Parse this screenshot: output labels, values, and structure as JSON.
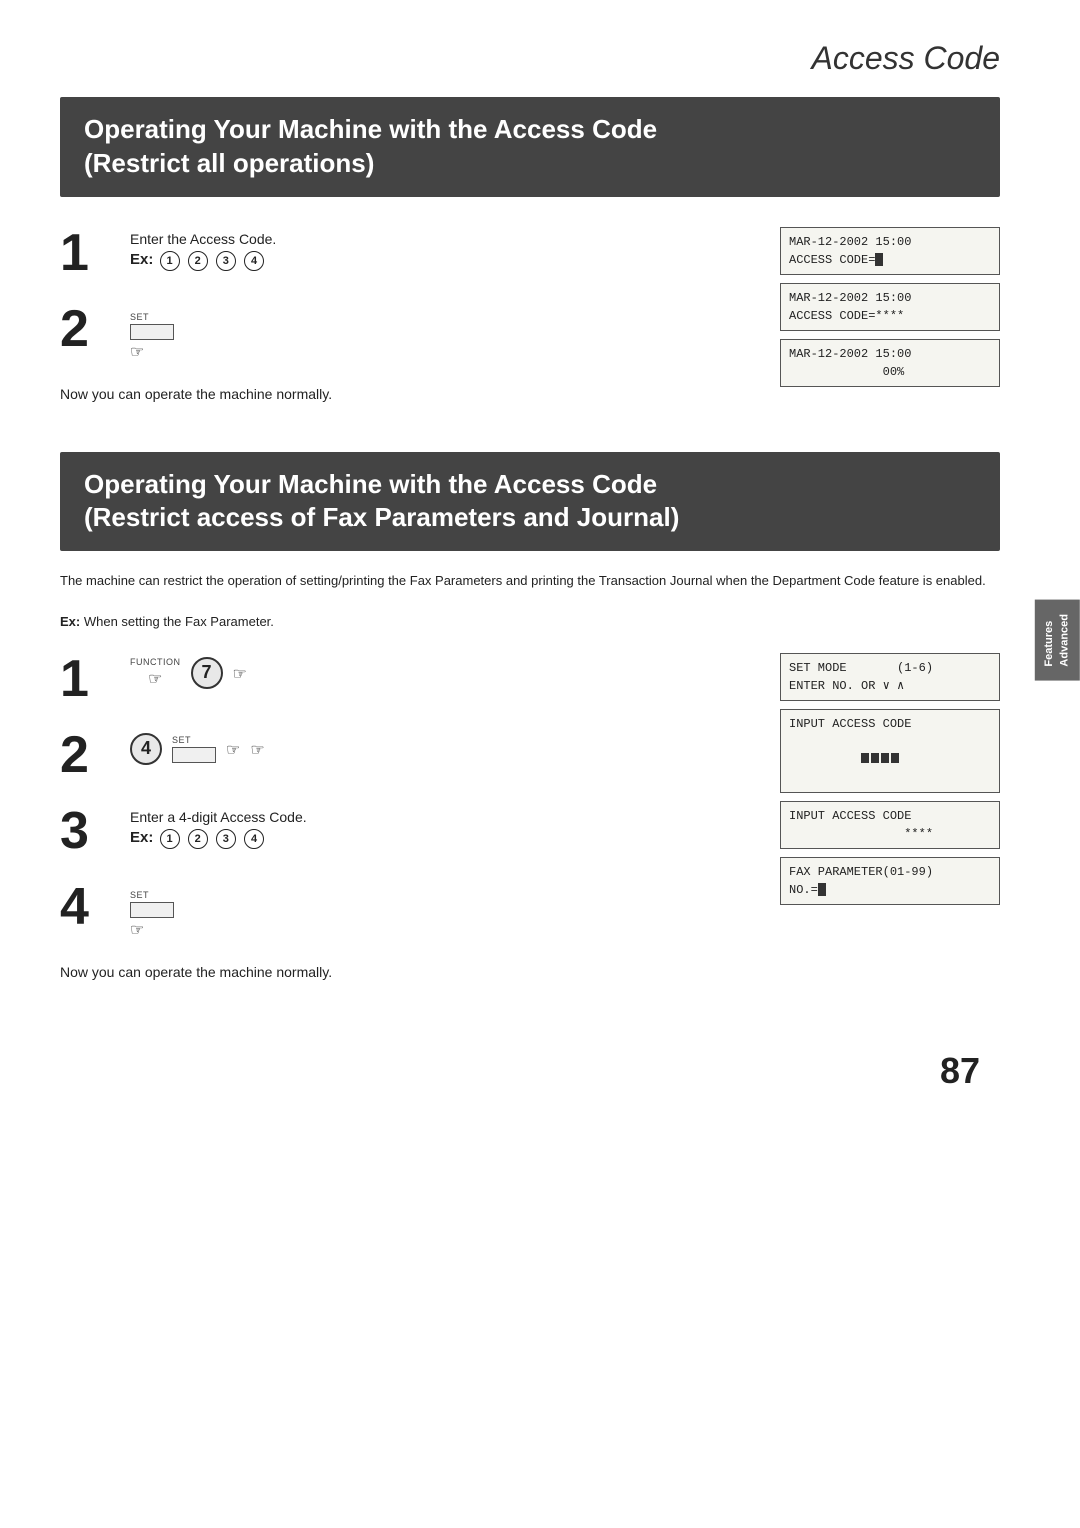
{
  "page": {
    "title": "Access Code",
    "page_number": "87",
    "side_tab": "Advanced\nFeatures"
  },
  "section1": {
    "header_line1": "Operating Your Machine with the Access Code",
    "header_line2": "(Restrict all operations)",
    "steps": [
      {
        "number": "1",
        "instruction": "Enter the Access Code.",
        "ex_label": "Ex:",
        "ex_digits": [
          "①",
          "②",
          "③",
          "④"
        ]
      },
      {
        "number": "2",
        "instruction": ""
      }
    ],
    "normal_text": "Now you can operate the machine normally.",
    "lcd_screens": [
      {
        "line1": "MAR-12-2002 15:00",
        "line2": "ACCESS CODE=■"
      },
      {
        "line1": "MAR-12-2002 15:00",
        "line2": "ACCESS CODE=****"
      },
      {
        "line1": "MAR-12-2002 15:00",
        "line2": "             00%"
      }
    ]
  },
  "section2": {
    "header_line1": "Operating Your Machine with the Access Code",
    "header_line2": "(Restrict access of Fax Parameters and Journal)",
    "description": "The machine can restrict the operation of setting/printing the Fax Parameters and printing the Transaction Journal when the Department Code feature is enabled.",
    "ex_desc": "Ex: When setting the Fax Parameter.",
    "steps": [
      {
        "number": "1",
        "func_label": "FUNCTION",
        "func_key": "7"
      },
      {
        "number": "2",
        "key": "4",
        "set_label": "SET"
      },
      {
        "number": "3",
        "instruction": "Enter a 4-digit Access Code.",
        "ex_label": "Ex:",
        "ex_digits": [
          "①",
          "②",
          "③",
          "④"
        ]
      },
      {
        "number": "4",
        "set_label": "SET"
      }
    ],
    "normal_text": "Now you can operate the machine normally.",
    "lcd_screens": [
      {
        "line1": "SET MODE       (1-6)",
        "line2": "ENTER NO. OR ∨ ∧"
      },
      {
        "line1": "INPUT ACCESS CODE",
        "line2": "            ████"
      },
      {
        "line1": "INPUT ACCESS CODE",
        "line2": "                ****"
      },
      {
        "line1": "FAX PARAMETER(01-99)",
        "line2": "NO.=■"
      }
    ]
  }
}
